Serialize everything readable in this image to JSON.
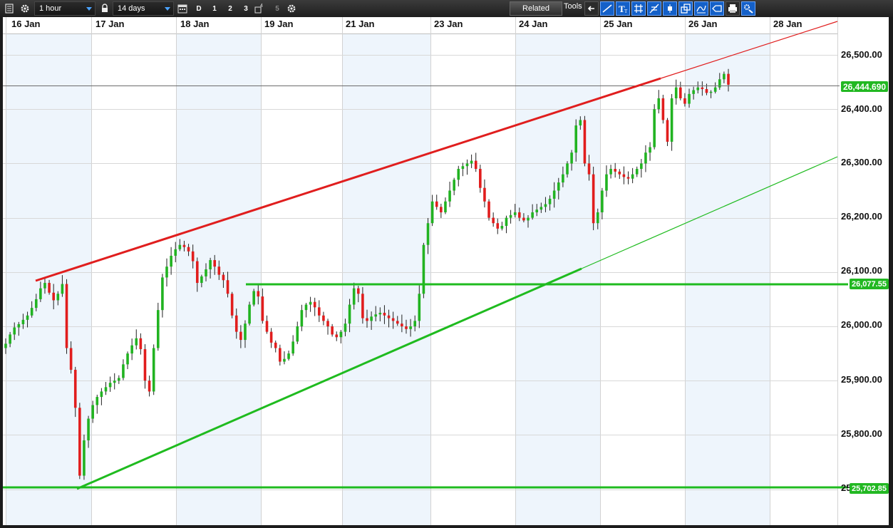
{
  "toolbar": {
    "interval": "1 hour",
    "range": "14 days",
    "period_buttons": [
      "D",
      "1",
      "2",
      "3",
      "5"
    ],
    "related_label": "Related",
    "tools_label": "Tools"
  },
  "chart_data": {
    "type": "candlestick",
    "instrument": "",
    "x_axis_labels": [
      "16 Jan",
      "17 Jan",
      "18 Jan",
      "19 Jan",
      "21 Jan",
      "23 Jan",
      "24 Jan",
      "25 Jan",
      "26 Jan",
      "28 Jan"
    ],
    "y_axis_labels": [
      "26,500.00",
      "26,400.00",
      "26,300.00",
      "26,200.00",
      "26,100.00",
      "26,000.00",
      "25,900.00",
      "25,800.00",
      "25,700.00"
    ],
    "ylim": [
      25680,
      26570
    ],
    "current_price": "26,444.690",
    "horizontal_levels": [
      {
        "label": "26,077.55",
        "value": 26077.55,
        "color": "#1fbb1f"
      },
      {
        "label": "25,702.85",
        "value": 25702.85,
        "color": "#1fbb1f"
      }
    ],
    "trend_lines": [
      {
        "name": "upper-resistance",
        "color": "#e01e1e",
        "from_value": 26083,
        "to_value": 26455
      },
      {
        "name": "lower-support",
        "color": "#1fbb1f",
        "from_value": 25702,
        "to_value": 26105
      }
    ],
    "closes": [
      25968,
      25985,
      25998,
      26004,
      26012,
      26020,
      26034,
      26050,
      26070,
      26080,
      26062,
      26048,
      26060,
      26078,
      25960,
      25920,
      25850,
      25725,
      25790,
      25830,
      25855,
      25870,
      25880,
      25888,
      25896,
      25900,
      25905,
      25930,
      25950,
      25965,
      25978,
      25958,
      25900,
      25880,
      25960,
      26030,
      26090,
      26110,
      26130,
      26142,
      26150,
      26146,
      26138,
      26120,
      26080,
      26092,
      26105,
      26122,
      26110,
      26095,
      26085,
      26060,
      26020,
      25990,
      25975,
      26005,
      26040,
      26065,
      26055,
      26010,
      25990,
      25970,
      25960,
      25935,
      25940,
      25950,
      25972,
      26000,
      26030,
      26040,
      26045,
      26035,
      26020,
      26010,
      26000,
      25985,
      25980,
      25990,
      26005,
      26040,
      26070,
      26060,
      26015,
      26010,
      26018,
      26022,
      26025,
      26020,
      26015,
      26010,
      26005,
      26000,
      25995,
      26000,
      26010,
      26060,
      26150,
      26190,
      26230,
      26220,
      26210,
      26230,
      26250,
      26270,
      26290,
      26295,
      26300,
      26305,
      26290,
      26255,
      26230,
      26200,
      26190,
      26180,
      26185,
      26200,
      26205,
      26210,
      26200,
      26195,
      26200,
      26210,
      26215,
      26220,
      26225,
      26235,
      26250,
      26265,
      26280,
      26300,
      26320,
      26370,
      26380,
      26300,
      26280,
      26190,
      26210,
      26250,
      26280,
      26290,
      26285,
      26280,
      26275,
      26272,
      26280,
      26290,
      26300,
      26320,
      26330,
      26400,
      26420,
      26380,
      26340,
      26420,
      26440,
      26420,
      26410,
      26428,
      26435,
      26440,
      26437,
      26430,
      26432,
      26440,
      26455,
      26465,
      26445
    ]
  }
}
